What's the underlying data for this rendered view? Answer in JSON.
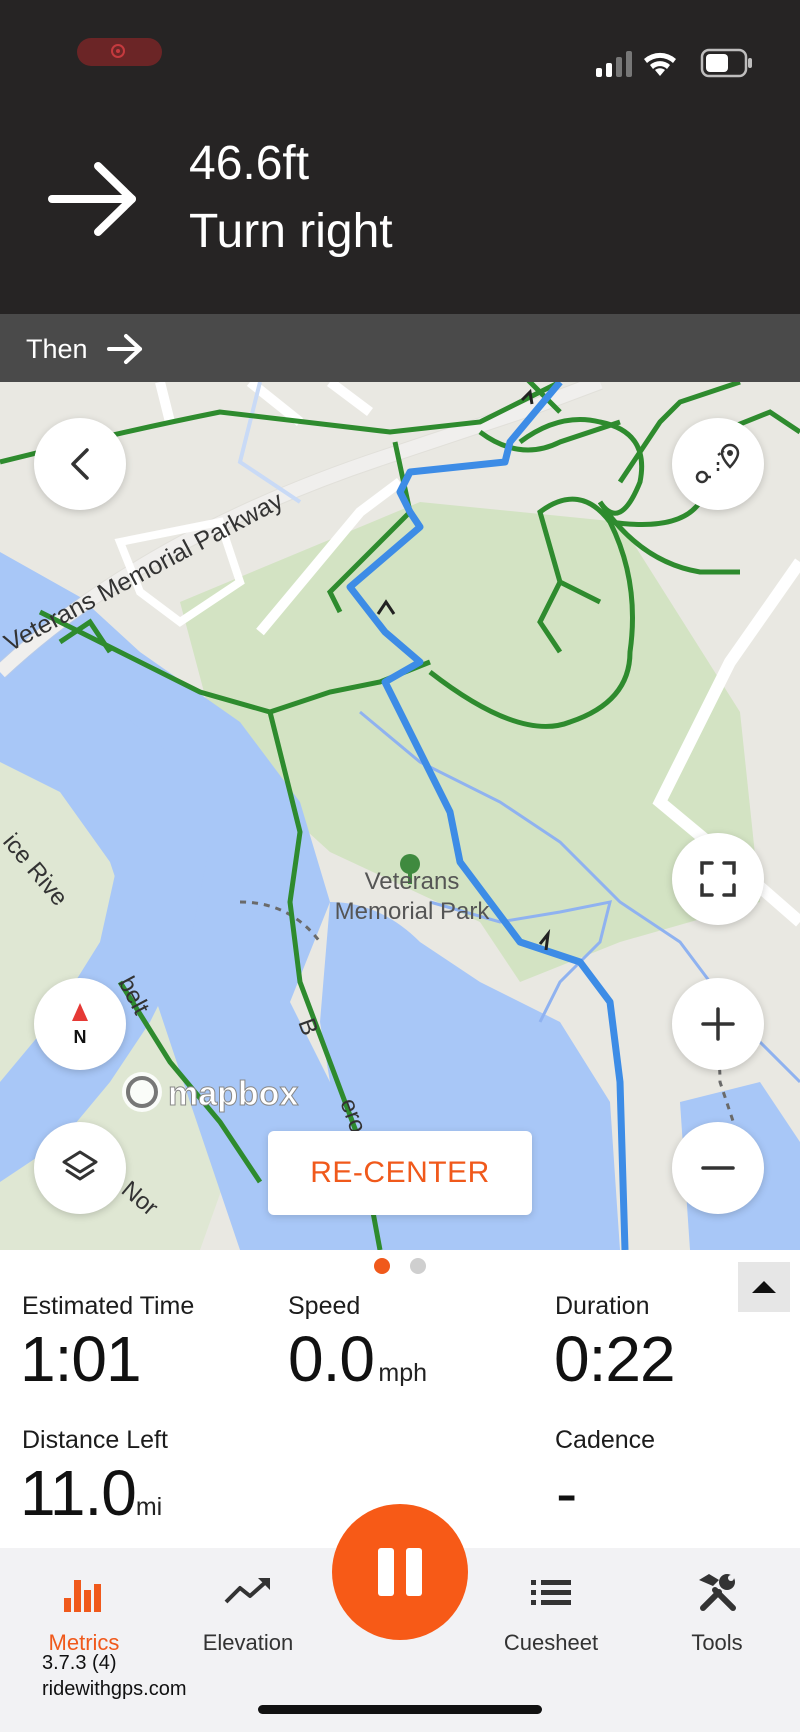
{
  "status_bar": {
    "recording_indicator": "screen-record-icon"
  },
  "navigation": {
    "distance": "46.6ft",
    "instruction": "Turn right",
    "turn_icon": "arrow-right-icon",
    "then_label": "Then",
    "then_icon": "arrow-right-icon"
  },
  "map": {
    "labels": {
      "parkway": "Veterans Memorial Parkway",
      "park_line1": "Veterans",
      "park_line2": "Memorial Park",
      "river": "ice Rive",
      "road1": "belt",
      "road2": "B",
      "road3": "ero",
      "road4": "Nor"
    },
    "attribution": "mapbox",
    "recenter_label": "RE-CENTER",
    "compass_label": "N",
    "colors": {
      "route": "#3d8ce6",
      "trails": "#2e8b2e",
      "water": "#a8c7f7",
      "park": "#cfe0bd"
    }
  },
  "metrics": {
    "page_indicator": {
      "pages": 2,
      "active": 1,
      "active_color": "#f0591b"
    },
    "estimated_time": {
      "label": "Estimated Time",
      "value": "1:01"
    },
    "speed": {
      "label": "Speed",
      "value": "0.0",
      "unit": "mph"
    },
    "duration": {
      "label": "Duration",
      "value": "0:22"
    },
    "distance_left": {
      "label": "Distance Left",
      "value": "11.0",
      "unit": "mi"
    },
    "cadence": {
      "label": "Cadence",
      "value": "-"
    }
  },
  "tabs": {
    "metrics": "Metrics",
    "elevation": "Elevation",
    "cuesheet": "Cuesheet",
    "tools": "Tools",
    "active_color": "#f0591b"
  },
  "footer": {
    "version": "3.7.3 (4)",
    "site": "ridewithgps.com"
  }
}
